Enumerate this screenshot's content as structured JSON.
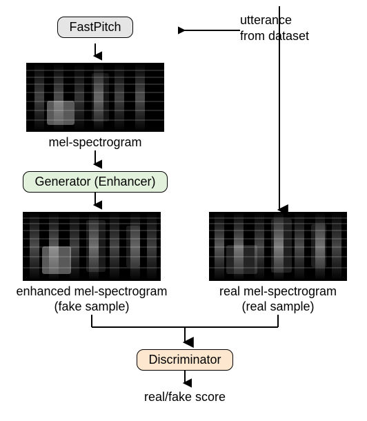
{
  "nodes": {
    "fastpitch": "FastPitch",
    "generator": "Generator (Enhancer)",
    "discriminator": "Discriminator"
  },
  "labels": {
    "input_top_line1": "utterance",
    "input_top_line2": "from dataset",
    "mel": "mel-spectrogram",
    "enhanced_line1": "enhanced mel-spectrogram",
    "enhanced_line2": "(fake sample)",
    "real_line1": "real mel-spectrogram",
    "real_line2": "(real sample)",
    "output": "real/fake score"
  }
}
